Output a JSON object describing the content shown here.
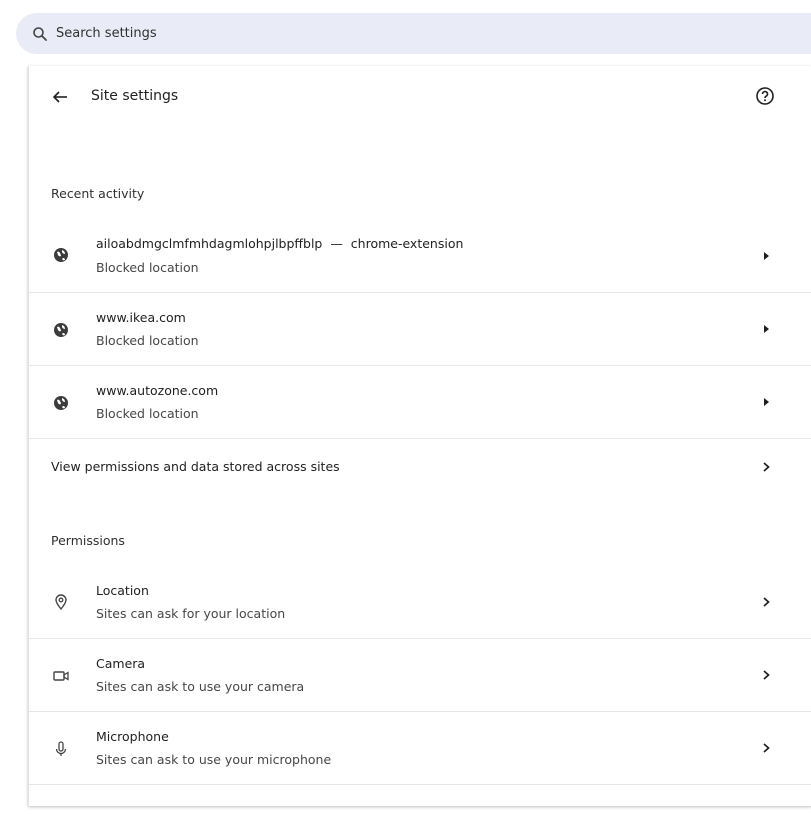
{
  "search": {
    "placeholder": "Search settings"
  },
  "header": {
    "title": "Site settings"
  },
  "recent_activity": {
    "title": "Recent activity",
    "items": [
      {
        "site": "ailoabdmgclmfmhdagmlohpjlbpffblp",
        "separator": "—",
        "source": "chrome-extension",
        "status": "Blocked location"
      },
      {
        "site": "www.ikea.com",
        "status": "Blocked location"
      },
      {
        "site": "www.autozone.com",
        "status": "Blocked location"
      }
    ]
  },
  "view_permissions_label": "View permissions and data stored across sites",
  "permissions": {
    "title": "Permissions",
    "items": [
      {
        "label": "Location",
        "description": "Sites can ask for your location",
        "icon": "location-pin-icon"
      },
      {
        "label": "Camera",
        "description": "Sites can ask to use your camera",
        "icon": "camera-icon"
      },
      {
        "label": "Microphone",
        "description": "Sites can ask to use your microphone",
        "icon": "microphone-icon"
      }
    ]
  }
}
